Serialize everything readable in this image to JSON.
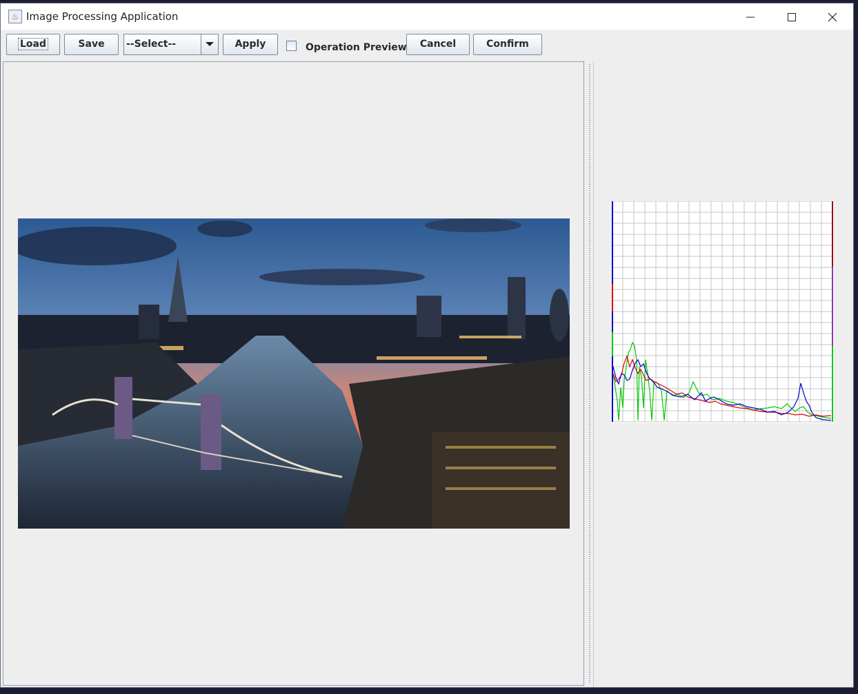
{
  "window": {
    "title": "Image Processing Application",
    "controls": [
      "minimize",
      "maximize",
      "close"
    ]
  },
  "toolbar": {
    "load_label": "Load",
    "save_label": "Save",
    "operation_select": {
      "value": "--Select--"
    },
    "apply_label": "Apply",
    "preview_checkbox_checked": false,
    "preview_label": "Operation Preview:",
    "cancel_label": "Cancel",
    "confirm_label": "Confirm"
  },
  "image": {
    "description_icon": "photo-icon"
  },
  "histogram": {
    "grid": true,
    "background": "#ffffff",
    "grid_color": "#c4c4c4",
    "series_colors": {
      "red": "#e00000",
      "green": "#00c800",
      "blue": "#0000cc"
    }
  },
  "colors": {
    "window_bg": "#eeeeee",
    "panel_border": "#8ea0b8",
    "desktop_bg": "#1b1d33"
  }
}
